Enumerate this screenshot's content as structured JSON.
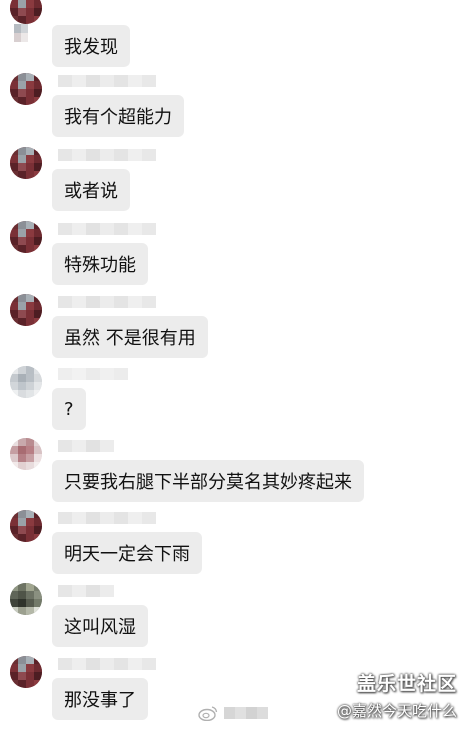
{
  "messages": [
    {
      "text": "我发现"
    },
    {
      "text": "我有个超能力"
    },
    {
      "text": "或者说"
    },
    {
      "text": "特殊功能"
    },
    {
      "text": "虽然 不是很有用"
    },
    {
      "text": "?"
    },
    {
      "text": "只要我右腿下半部分莫名其妙疼起来"
    },
    {
      "text": "明天一定会下雨"
    },
    {
      "text": "这叫风湿"
    },
    {
      "text": "那没事了"
    }
  ],
  "watermark": {
    "title": "盖乐世社区",
    "subtitle": "@嘉然今天吃什么"
  },
  "colors": {
    "bubble": "#ececec",
    "text": "#111111",
    "background": "#ffffff"
  },
  "icons": {
    "avatar": "avatar-pixelated",
    "weibo": "weibo-logo-icon"
  }
}
